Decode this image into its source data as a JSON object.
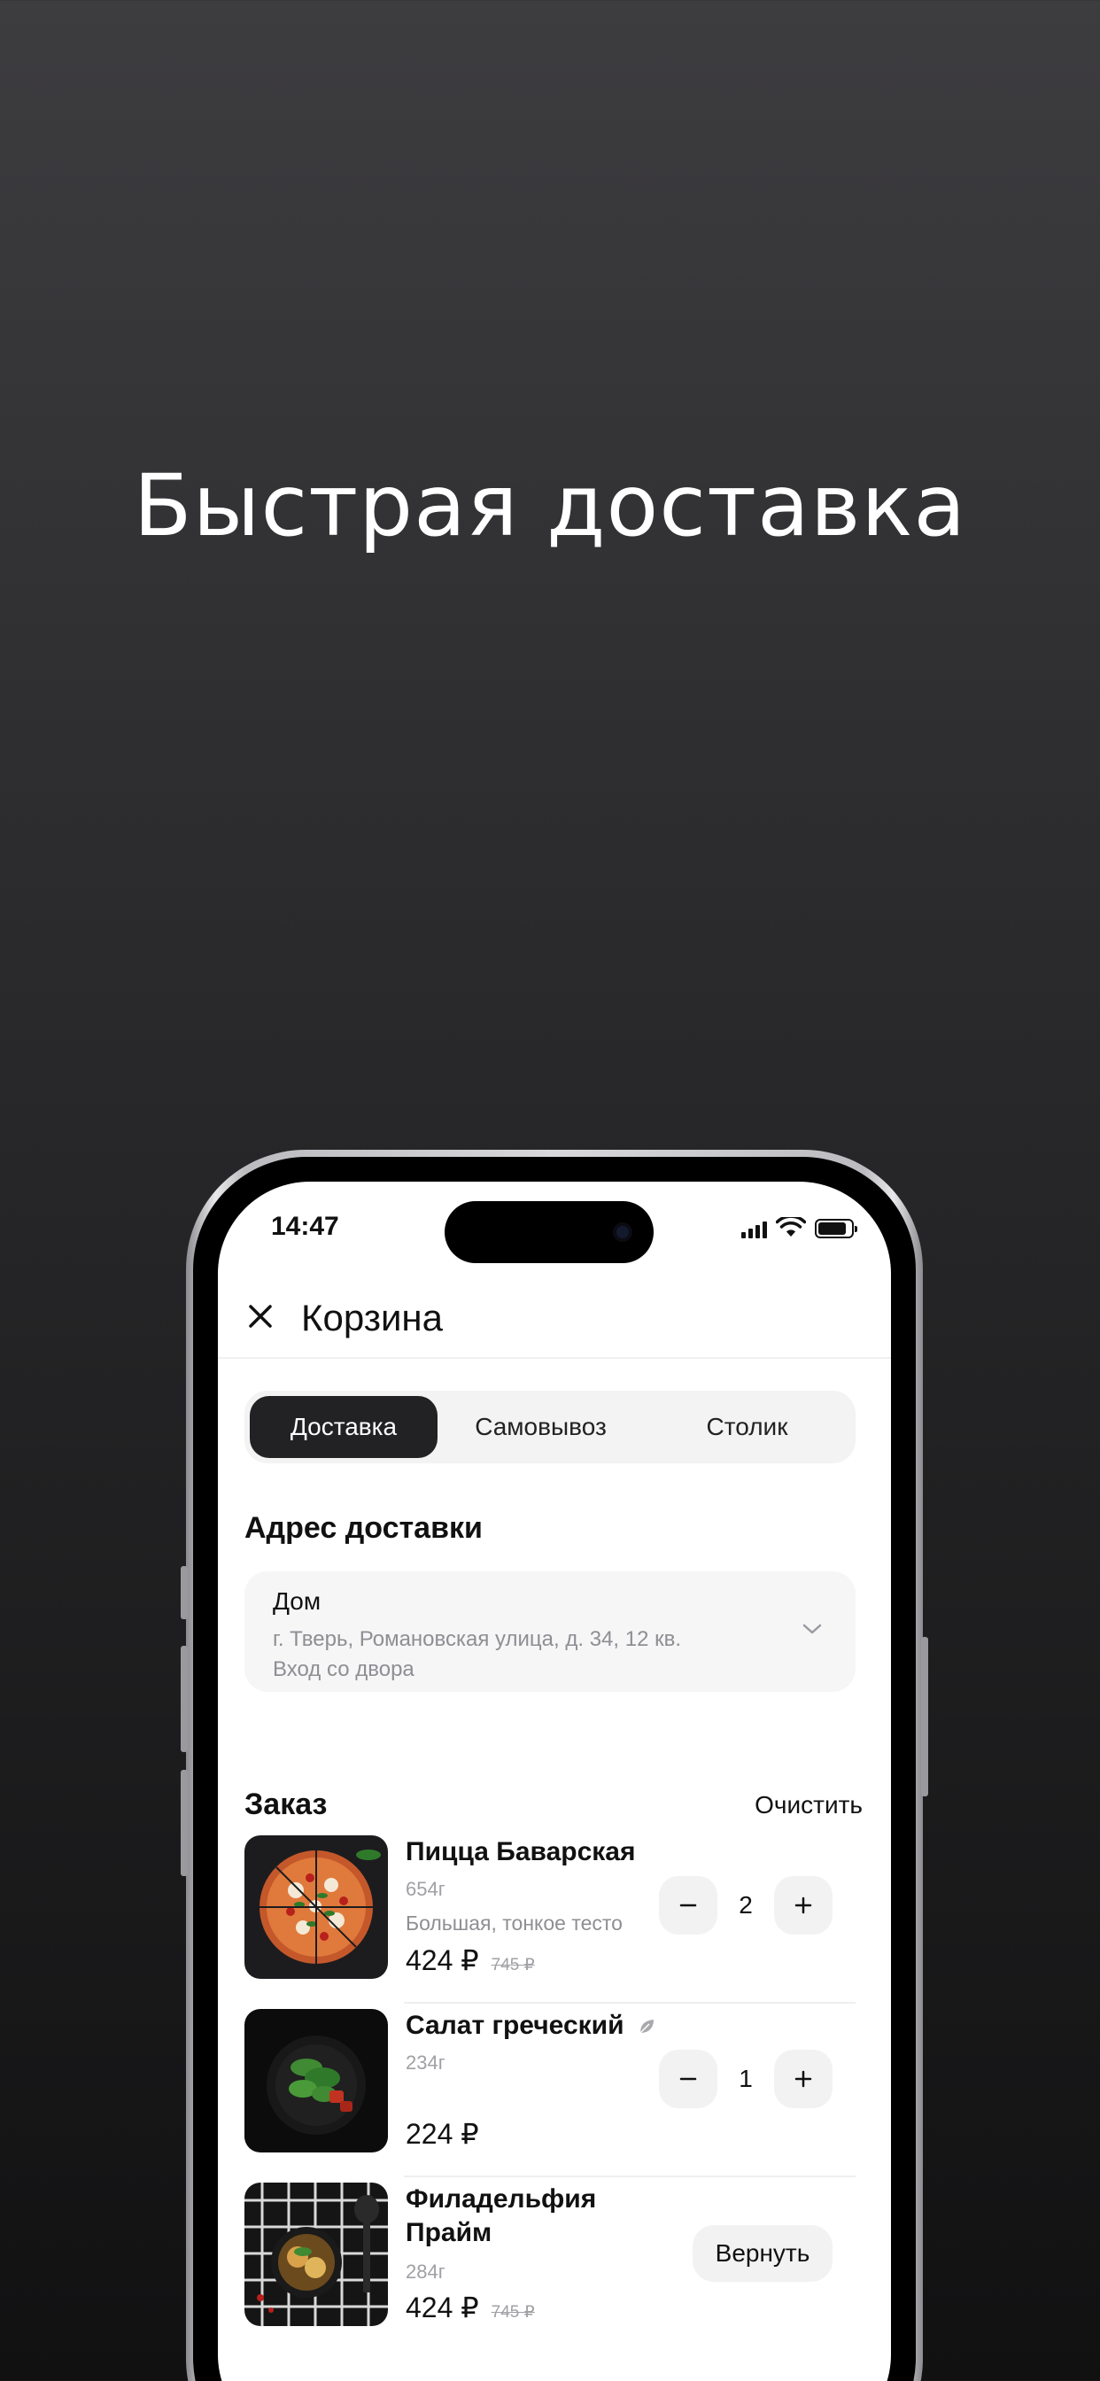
{
  "headline": "Быстрая доставка",
  "status": {
    "time": "14:47"
  },
  "header": {
    "title": "Корзина"
  },
  "tabs": [
    {
      "label": "Доставка",
      "active": true
    },
    {
      "label": "Самовывоз",
      "active": false
    },
    {
      "label": "Столик",
      "active": false
    }
  ],
  "address": {
    "section_title": "Адрес доставки",
    "name": "Дом",
    "line1": "г. Тверь, Романовская улица, д. 34, 12 кв.",
    "line2": "Вход со двора"
  },
  "order": {
    "section_title": "Заказ",
    "clear_label": "Очистить",
    "items": [
      {
        "name": "Пицца Баварская",
        "weight": "654г",
        "desc": "Большая, тонкое тесто",
        "price": "424 ₽",
        "old_price": "745 ₽",
        "qty": "2"
      },
      {
        "name": "Салат греческий",
        "weight": "234г",
        "desc": "",
        "price": "224 ₽",
        "old_price": "",
        "qty": "1"
      },
      {
        "name": "Филадельфия Прайм",
        "weight": "284г",
        "desc": "",
        "price": "424 ₽",
        "old_price": "745 ₽",
        "action_label": "Вернуть"
      }
    ]
  },
  "icons": {
    "close": "close-icon",
    "chevron": "chevron-down-icon",
    "leaf": "leaf-icon",
    "minus": "minus-icon",
    "plus": "plus-icon"
  }
}
